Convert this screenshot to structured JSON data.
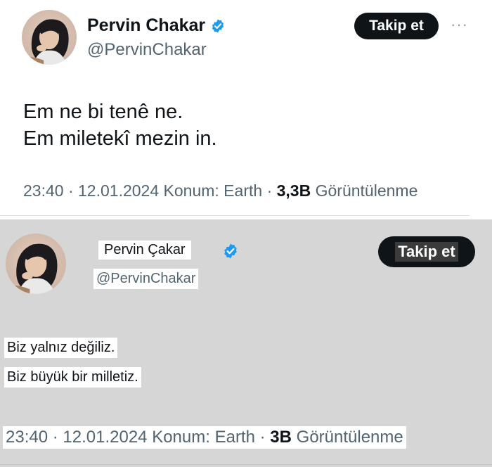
{
  "top_tweet": {
    "display_name": "Pervin Chakar",
    "handle": "@PervinChakar",
    "follow_label": "Takip et",
    "more_label": "···",
    "text_lines": [
      "Em ne bi tenê ne.",
      "Em miletekî mezin in."
    ],
    "time": "23:40",
    "date": "12.01.2024",
    "location": "Konum: Earth",
    "views_count": "3,3B",
    "views_label": "Görüntülenme",
    "separator": "·"
  },
  "bottom_tweet": {
    "display_name": "Pervin Çakar",
    "handle": "@PervinChakar",
    "follow_label": "Takip et",
    "text_lines": [
      "Biz yalnız değiliz.",
      "Biz büyük bir milletiz."
    ],
    "time": "23:40",
    "date": "12.01.2024",
    "location": "Konum: Earth",
    "views_count": "3B",
    "views_label": "Görüntülenme",
    "separator": "·"
  },
  "colors": {
    "verified_blue": "#1d9bf0",
    "text_primary": "#0f1419",
    "text_secondary": "#536471",
    "follow_button": "#0f1419",
    "gray_panel": "#d6d6d6"
  },
  "icons": {
    "avatar": "profile-photo",
    "verified": "verified-badge-icon",
    "more": "more-horizontal-icon"
  }
}
